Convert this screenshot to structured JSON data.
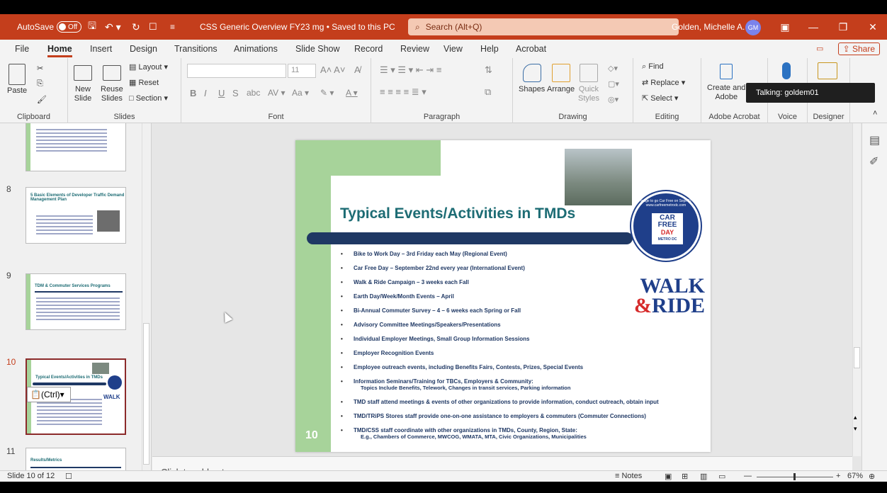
{
  "titlebar": {
    "autosave_label": "AutoSave",
    "autosave_state": "Off",
    "document_title": "CSS Generic Overview FY23 mg • Saved to this PC",
    "search_placeholder": "Search (Alt+Q)",
    "user_name": "Golden, Michelle A.",
    "user_initials": "GM"
  },
  "menu": {
    "items": [
      "File",
      "Home",
      "Insert",
      "Design",
      "Transitions",
      "Animations",
      "Slide Show",
      "Record",
      "Review",
      "View",
      "Help",
      "Acrobat"
    ],
    "share_label": "Share"
  },
  "ribbon": {
    "clipboard": {
      "paste": "Paste",
      "label": "Clipboard"
    },
    "slides": {
      "new_slide_1": "New",
      "new_slide_2": "Slide",
      "reuse_1": "Reuse",
      "reuse_2": "Slides",
      "layout": "Layout",
      "reset": "Reset",
      "section": "Section",
      "label": "Slides"
    },
    "font": {
      "size": "11",
      "bold": "B",
      "italic": "I",
      "underline": "U",
      "shadow": "S",
      "label": "Font"
    },
    "paragraph": {
      "label": "Paragraph"
    },
    "drawing": {
      "shapes": "Shapes",
      "arrange": "Arrange",
      "quick_1": "Quick",
      "quick_2": "Styles",
      "label": "Drawing"
    },
    "editing": {
      "find": "Find",
      "replace": "Replace",
      "select": "Select",
      "label": "Editing"
    },
    "acrobat": {
      "create_1": "Create and",
      "create_2": "Adobe",
      "label": "Adobe Acrobat"
    },
    "voice": {
      "label": "Voice"
    },
    "designer": {
      "label": "Designer"
    }
  },
  "tooltip": "Talking: goldem01",
  "thumbnails": [
    {
      "num": "8",
      "title": "5 Basic Elements of Developer Traffic Demand Management Plan"
    },
    {
      "num": "9",
      "title": "TDM & Commuter Services Programs"
    },
    {
      "num": "10",
      "title": "Typical Events/Activities in TMDs"
    },
    {
      "num": "11",
      "title": "Results/Metrics"
    }
  ],
  "paste_options": "(Ctrl)",
  "slide": {
    "title": "Typical Events/Activities in TMDs",
    "number": "10",
    "bullets": [
      "Bike to Work Day – 3rd Friday each May (Regional Event)",
      "Car Free Day – September 22nd every year (International Event)",
      "Walk & Ride Campaign – 3 weeks each Fall",
      "Earth Day/Week/Month Events – April",
      "Bi-Annual Commuter Survey – 4 – 6 weeks each Spring or Fall",
      "Advisory Committee Meetings/Speakers/Presentations",
      "Individual Employer Meetings, Small Group Information Sessions",
      "Employer Recognition Events",
      "Employee outreach events, including Benefits Fairs, Contests, Prizes, Special Events",
      "Information Seminars/Training for TBCs, Employers & Community:",
      "TMD staff attend meetings & events of other organizations to provide information, conduct outreach, obtain input",
      "TMD/TRiPS Stores staff provide one-on-one assistance to employers & commuters (Commuter Connections)",
      "TMD/CSS staff coordinate with other organizations in TMDs, County, Region, State:"
    ],
    "sub_bullet_1": "Topics Include Benefits, Telework, Changes in transit services, Parking information",
    "sub_bullet_2": "E.g., Chambers of Commerce, MWCOG, WMATA, MTA, Civic Organizations, Municipalities",
    "badge_car": "CAR",
    "badge_free": "FREE",
    "badge_day": "DAY",
    "badge_sub": "METRO DC",
    "badge_ring": "Pledge to go Car Free on Sept 22 · www.carfreemetrodc.com",
    "walk": "WALK",
    "ride": "RIDE",
    "amp": "&"
  },
  "notes_placeholder": "Click to add notes",
  "status": {
    "slide_count": "Slide 10 of 12",
    "notes": "Notes",
    "zoom": "67%"
  }
}
